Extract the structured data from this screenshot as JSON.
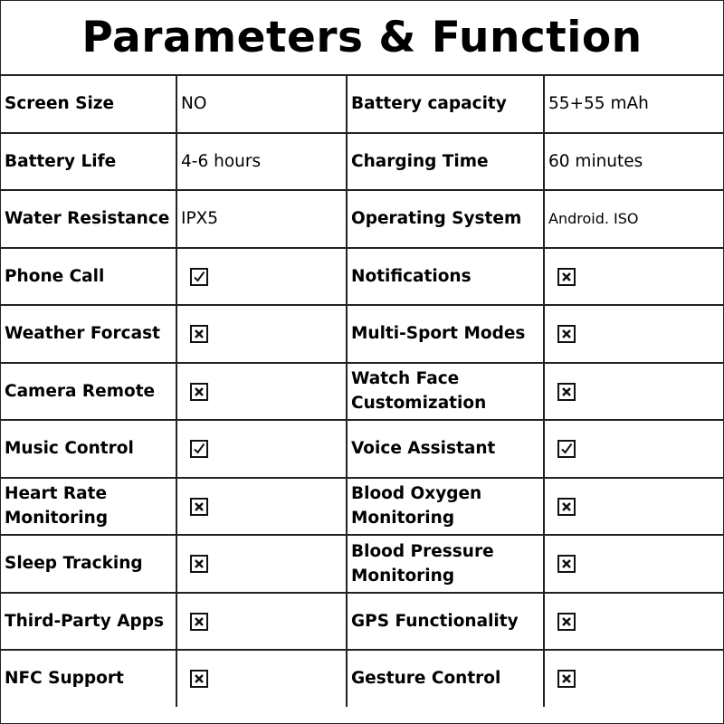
{
  "title": "Parameters & Function",
  "rows": [
    [
      {
        "label": "Screen Size",
        "value": "NO"
      },
      {
        "label": "Battery capacity",
        "value": "55+55 mAh"
      }
    ],
    [
      {
        "label": "Battery Life",
        "value": "4-6 hours"
      },
      {
        "label": "Charging Time",
        "value": "60 minutes"
      }
    ],
    [
      {
        "label": "Water Resistance",
        "value": "IPX5"
      },
      {
        "label": "Operating System",
        "value": "Android. ISO"
      }
    ],
    [
      {
        "label": "Phone Call",
        "status": "check"
      },
      {
        "label": "Notifications",
        "status": "cross"
      }
    ],
    [
      {
        "label": "Weather Forcast",
        "status": "cross"
      },
      {
        "label": "Multi-Sport Modes",
        "status": "cross"
      }
    ],
    [
      {
        "label": "Camera Remote",
        "status": "cross"
      },
      {
        "label": "Watch Face Customization",
        "status": "cross"
      }
    ],
    [
      {
        "label": "Music Control",
        "status": "check"
      },
      {
        "label": "Voice Assistant",
        "status": "check"
      }
    ],
    [
      {
        "label": "Heart Rate Monitoring",
        "status": "cross"
      },
      {
        "label": "Blood Oxygen Monitoring",
        "status": "cross"
      }
    ],
    [
      {
        "label": "Sleep Tracking",
        "status": "cross"
      },
      {
        "label": "Blood Pressure Monitoring",
        "status": "cross"
      }
    ],
    [
      {
        "label": "Third-Party Apps",
        "status": "cross"
      },
      {
        "label": "GPS Functionality",
        "status": "cross"
      }
    ],
    [
      {
        "label": "NFC Support",
        "status": "cross"
      },
      {
        "label": "Gesture Control",
        "status": "cross"
      }
    ]
  ],
  "icons": {
    "check": "check-box-icon",
    "cross": "cross-box-icon"
  }
}
